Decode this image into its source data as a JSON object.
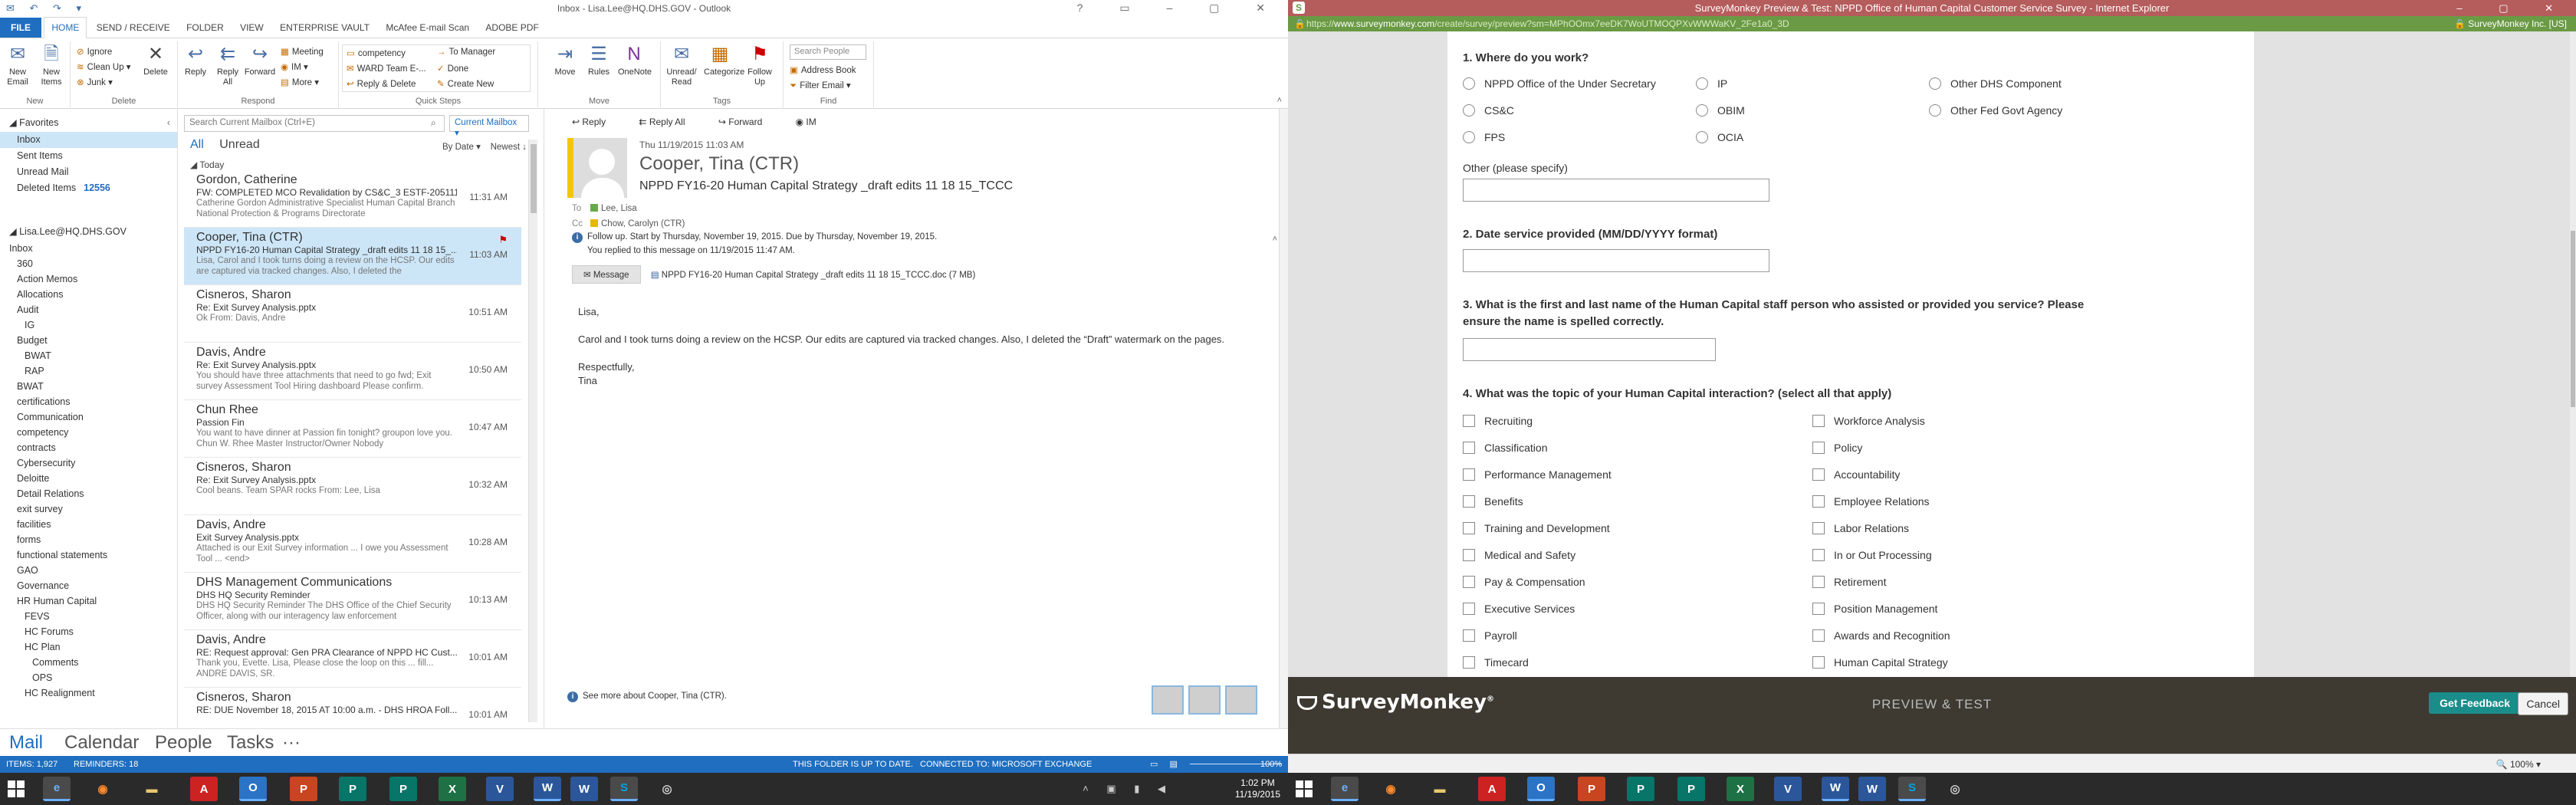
{
  "outlook": {
    "title": "Inbox - Lisa.Lee@HQ.DHS.GOV - Outlook",
    "tabs": [
      "FILE",
      "HOME",
      "SEND / RECEIVE",
      "FOLDER",
      "VIEW",
      "ENTERPRISE VAULT",
      "McAfee E-mail Scan",
      "ADOBE PDF"
    ],
    "ribbon": {
      "new_email": "New Email",
      "new_items": "New Items",
      "ignore": "Ignore",
      "clean_up": "Clean Up",
      "junk": "Junk",
      "delete": "Delete",
      "reply": "Reply",
      "reply_all": "Reply All",
      "forward": "Forward",
      "meeting": "Meeting",
      "im": "IM",
      "more": "More",
      "qs_competency": "competency",
      "qs_ward": "WARD Team E-...",
      "qs_reply_delete": "Reply & Delete",
      "qs_to_manager": "To Manager",
      "qs_done": "Done",
      "qs_create_new": "Create New",
      "move": "Move",
      "rules": "Rules",
      "onenote": "OneNote",
      "unread_read": "Unread/ Read",
      "categorize": "Categorize",
      "follow_up": "Follow Up",
      "search_people": "Search People",
      "address_book": "Address Book",
      "filter_email": "Filter Email",
      "groups": [
        "New",
        "Delete",
        "Respond",
        "Quick Steps",
        "Move",
        "Tags",
        "Find"
      ]
    },
    "folders": {
      "favorites": "Favorites",
      "fav_items": [
        {
          "label": "Inbox",
          "count": ""
        },
        {
          "label": "Sent Items",
          "count": ""
        },
        {
          "label": "Unread Mail",
          "count": ""
        },
        {
          "label": "Deleted Items",
          "count": "12556"
        }
      ],
      "account": "Lisa.Lee@HQ.DHS.GOV",
      "tree": [
        "Inbox",
        "360",
        "Action Memos",
        "Allocations",
        "Audit",
        "IG",
        "Budget",
        "BWAT",
        "RAP",
        "BWAT",
        "certifications",
        "Communication",
        "competency",
        "contracts",
        "Cybersecurity",
        "Deloitte",
        "Detail Relations",
        "exit survey",
        "facilities",
        "forms",
        "functional statements",
        "GAO",
        "Governance",
        "HR Human Capital",
        "FEVS",
        "HC Forums",
        "HC Plan",
        "Comments",
        "OPS",
        "HC Realignment"
      ]
    },
    "list": {
      "search_placeholder": "Search Current Mailbox (Ctrl+E)",
      "current_mailbox": "Current Mailbox",
      "filter_all": "All",
      "filter_unread": "Unread",
      "sort_by": "By Date",
      "sort_order": "Newest",
      "group_today": "Today",
      "messages": [
        {
          "from": "Gordon, Catherine",
          "subject": "FW: COMPLETED MCO Revalidation by CS&C_3 ESTF-205111...",
          "preview": "Catherine Gordon  Administrative Specialist  Human Capital Branch  National Protection & Programs Directorate",
          "time": "11:31 AM",
          "flag": ""
        },
        {
          "from": "Cooper, Tina (CTR)",
          "subject": "NPPD FY16-20 Human Capital Strategy _draft edits 11 18 15_...",
          "preview": "Lisa,  Carol and I took turns doing a review on the HCSP.  Our edits are captured via tracked changes.  Also, I deleted the",
          "time": "11:03 AM",
          "flag": "⚑"
        },
        {
          "from": "Cisneros, Sharon",
          "subject": "Re: Exit Survey Analysis.pptx",
          "preview": "Ok  From: Davis, Andre",
          "time": "10:51 AM",
          "flag": ""
        },
        {
          "from": "Davis, Andre",
          "subject": "Re: Exit Survey Analysis.pptx",
          "preview": "You should have three attachments that need to go fwd;  Exit survey  Assessment Tool  Hiring dashboard Please confirm.",
          "time": "10:50 AM",
          "flag": ""
        },
        {
          "from": "Chun Rhee",
          "subject": "Passion Fin",
          "preview": "You want to have dinner at Passion fin tonight? groupon love you.  Chun W. Rhee  Master Instructor/Owner  Nobody",
          "time": "10:47 AM",
          "flag": ""
        },
        {
          "from": "Cisneros, Sharon",
          "subject": "Re: Exit Survey Analysis.pptx",
          "preview": "Cool beans. Team SPAR rocks  From: Lee, Lisa",
          "time": "10:32 AM",
          "flag": ""
        },
        {
          "from": "Davis, Andre",
          "subject": "Exit Survey Analysis.pptx",
          "preview": "Attached is our Exit Survey information ... I owe you Assessment Tool ... <end>",
          "time": "10:28 AM",
          "flag": ""
        },
        {
          "from": "DHS Management Communications",
          "subject": "DHS HQ Security Reminder",
          "preview": "DHS HQ Security Reminder  The DHS Office of the Chief Security Officer, along with our interagency law enforcement",
          "time": "10:13 AM",
          "flag": ""
        },
        {
          "from": "Davis, Andre",
          "subject": "RE: Request approval: Gen PRA Clearance of NPPD HC Cust...",
          "preview": "Thank you, Evette.  Lisa,  Please close the loop on this ... fill...  ANDRE DAVIS, SR.",
          "time": "10:01 AM",
          "flag": ""
        },
        {
          "from": "Cisneros, Sharon",
          "subject": "RE: DUE November 18, 2015 AT 10:00 a.m. - DHS HROA Foll...",
          "preview": "",
          "time": "10:01 AM",
          "flag": ""
        }
      ]
    },
    "reading": {
      "actions": [
        "Reply",
        "Reply All",
        "Forward",
        "IM"
      ],
      "date": "Thu 11/19/2015 11:03 AM",
      "from": "Cooper, Tina (CTR)",
      "subject": "NPPD FY16-20 Human Capital Strategy _draft edits 11 18 15_TCCC",
      "to_label": "To",
      "to": "Lee, Lisa",
      "cc_label": "Cc",
      "cc": "Chow, Carolyn (CTR)",
      "followup": "Follow up.  Start by Thursday, November 19, 2015.  Due by Thursday, November 19, 2015.",
      "replied": "You replied to this message on 11/19/2015 11:47 AM.",
      "message_tab": "Message",
      "attachment": "NPPD FY16-20 Human Capital Strategy _draft edits 11 18 15_TCCC.doc (7 MB)",
      "greeting": "Lisa,",
      "body": "Carol and I took turns doing a review on the HCSP.  Our edits are captured via tracked changes.  Also, I deleted the “Draft” watermark on the pages.",
      "closing": "Respectfully,",
      "signature": "Tina",
      "see_more": "See more about Cooper, Tina (CTR)."
    },
    "nav": [
      "Mail",
      "Calendar",
      "People",
      "Tasks",
      "···"
    ],
    "status": {
      "items": "ITEMS: 1,927",
      "reminders": "REMINDERS: 18",
      "uptodate": "THIS FOLDER IS UP TO DATE.",
      "connected": "CONNECTED TO: MICROSOFT EXCHANGE",
      "zoom": "100%"
    },
    "clock": {
      "time": "1:02 PM",
      "date": "11/19/2015"
    }
  },
  "survey": {
    "window_title": "SurveyMonkey Preview & Test: NPPD Office of Human Capital Customer Service Survey - Internet Explorer",
    "url_prefix": "https://",
    "url_host": "www.surveymonkey.com",
    "url_path": "/create/survey/preview?sm=MPhOOmx7eeDK7WoUTMOQPXvWWWaKV_2Fe1a0_3D",
    "security": "SurveyMonkey Inc. [US]",
    "q1": {
      "title": "1. Where do you work?",
      "options": [
        "NPPD Office of the Under Secretary",
        "CS&C",
        "FPS",
        "IP",
        "OBIM",
        "OCIA",
        "Other DHS Component",
        "Other Fed Govt Agency"
      ],
      "other_label": "Other (please specify)"
    },
    "q2": {
      "title": "2. Date service provided (MM/DD/YYYY format)"
    },
    "q3": {
      "title": "3. What is the first and last name of the Human Capital staff person who assisted or provided you service? Please ensure the name is spelled correctly."
    },
    "q4": {
      "title": "4. What was the topic of your Human Capital interaction? (select all that apply)",
      "left": [
        "Recruiting",
        "Classification",
        "Performance Management",
        "Benefits",
        "Training and Development",
        "Medical and Safety",
        "Pay & Compensation",
        "Executive Services",
        "Payroll",
        "Timecard"
      ],
      "right": [
        "Workforce Analysis",
        "Policy",
        "Accountability",
        "Employee Relations",
        "Labor Relations",
        "In or Out Processing",
        "Retirement",
        "Position Management",
        "Awards and Recognition",
        "Human Capital Strategy"
      ]
    },
    "footer": {
      "logo": "SurveyMonkey",
      "mode": "PREVIEW & TEST",
      "feedback": "Get Feedback",
      "cancel": "Cancel"
    },
    "zoom": "100%"
  },
  "colors": {
    "outlook_blue": "#1f6ec0",
    "ie_title": "#b55c5c",
    "ie_addr": "#6a9a44",
    "sm_footer": "#3e3a32",
    "feedback": "#1a8d8a"
  }
}
